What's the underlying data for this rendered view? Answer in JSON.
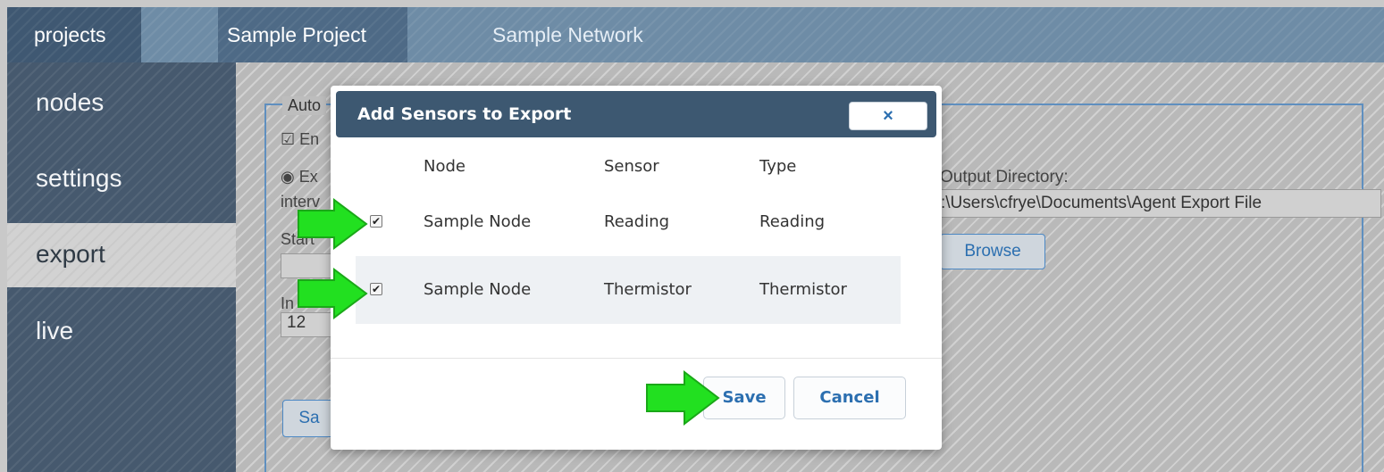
{
  "topnav": {
    "projects": "projects",
    "project": "Sample Project",
    "network": "Sample Network"
  },
  "sidebar": {
    "items": [
      {
        "label": "nodes"
      },
      {
        "label": "settings"
      },
      {
        "label": "export"
      },
      {
        "label": "live"
      }
    ]
  },
  "background": {
    "legend": "Auto",
    "enable_fragment": "En",
    "export_fragment": "Ex",
    "interval_fragment": "interv",
    "start_fragment": "Start",
    "interval_label_fragment": "In",
    "interval_value": "12",
    "output_label": "Output Directory:",
    "output_value": ":\\Users\\cfrye\\Documents\\Agent Export File",
    "browse": "Browse",
    "save_fragment": "Sa"
  },
  "modal": {
    "title": "Add Sensors to Export",
    "close": "×",
    "columns": [
      "Node",
      "Sensor",
      "Type"
    ],
    "rows": [
      {
        "node": "Sample Node",
        "sensor": "Reading",
        "type": "Reading",
        "checked": true
      },
      {
        "node": "Sample Node",
        "sensor": "Thermistor",
        "type": "Thermistor",
        "checked": true
      }
    ],
    "save": "Save",
    "cancel": "Cancel"
  },
  "colors": {
    "header": "#3d5871",
    "accent": "#2c6fb0",
    "arrow": "#22e020"
  }
}
